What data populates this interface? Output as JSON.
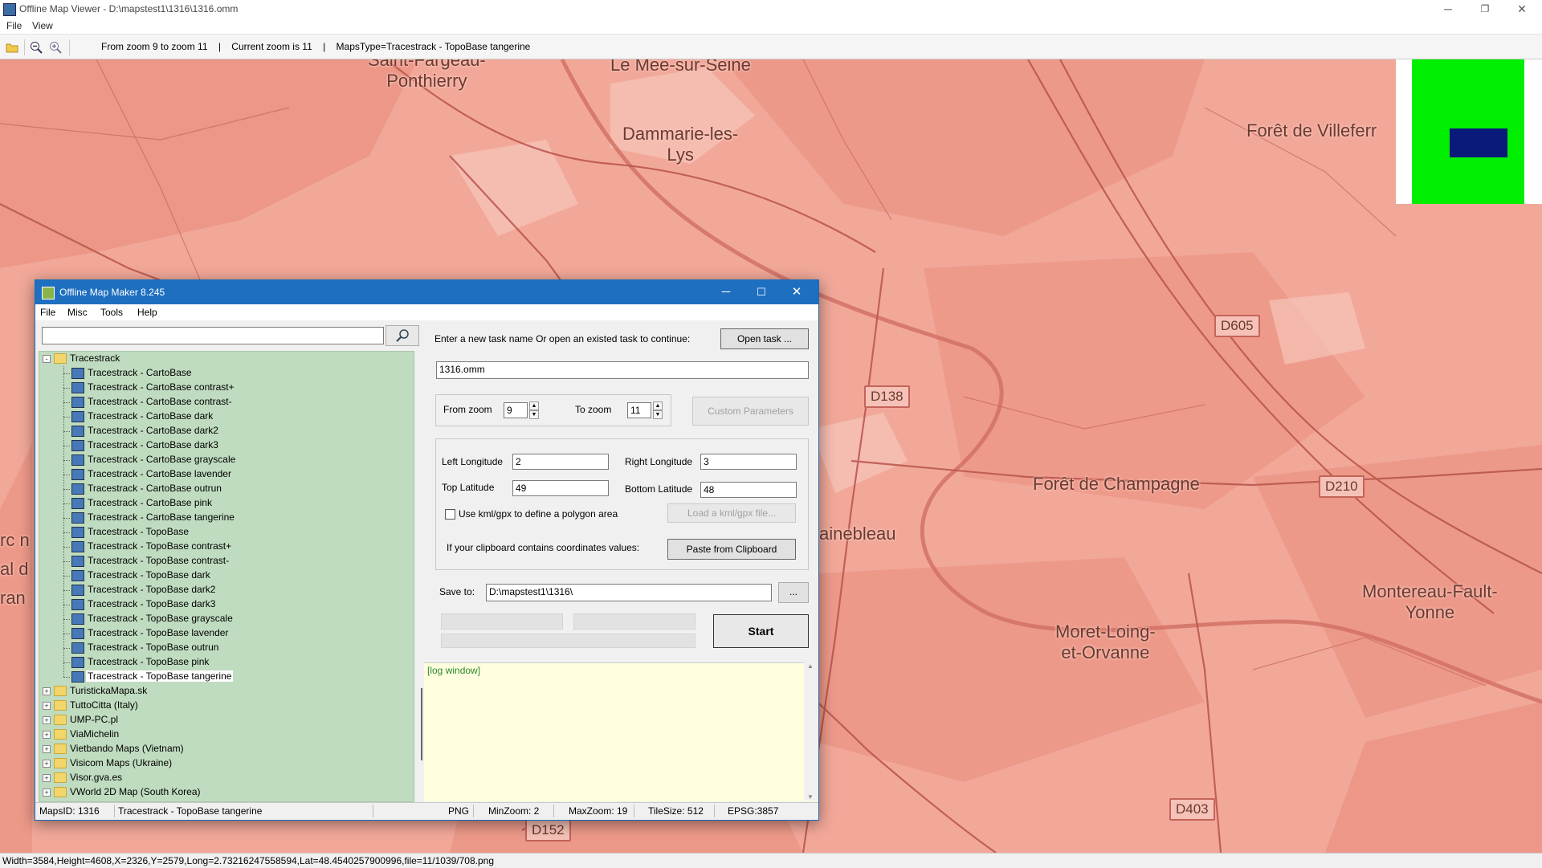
{
  "window": {
    "title": "Offline Map Viewer - D:\\mapstest1\\1316\\1316.omm",
    "menu": [
      "File",
      "View"
    ],
    "controls": {
      "minimize": "─",
      "maximize": "❐",
      "close": "✕"
    }
  },
  "toolbar": {
    "info": "From zoom 9 to zoom 11    |    Current zoom is 11    |    MapsType=Tracestrack - TopoBase tangerine"
  },
  "map": {
    "places": [
      "Saint-Fargeau-\nPonthierry",
      "Le Mee-sur-Seine",
      "Dammarie-les-\nLys",
      "Forêt de Villeferr",
      "Forêt de Champagne",
      "ainebleau",
      "Moret-Loing-\net-Orvanne",
      "Montereau-Fault-\nYonne",
      "rc n",
      "al d",
      "ran"
    ],
    "roads": [
      "D605",
      "D138",
      "D210",
      "D152",
      "D403"
    ]
  },
  "statusbar": {
    "text": "Width=3584,Height=4608,X=2326,Y=2579,Long=2.73216247558594,Lat=48.4540257900996,file=11/1039/708.png"
  },
  "dialog": {
    "title": "Offline Map Maker 8.245",
    "menu": [
      "File",
      "Misc",
      "Tools",
      "Help"
    ],
    "tree": {
      "root": "Tracestrack",
      "children": [
        "Tracestrack - CartoBase",
        "Tracestrack - CartoBase contrast+",
        "Tracestrack - CartoBase contrast-",
        "Tracestrack - CartoBase dark",
        "Tracestrack - CartoBase dark2",
        "Tracestrack - CartoBase dark3",
        "Tracestrack - CartoBase grayscale",
        "Tracestrack - CartoBase lavender",
        "Tracestrack - CartoBase outrun",
        "Tracestrack - CartoBase pink",
        "Tracestrack - CartoBase tangerine",
        "Tracestrack - TopoBase",
        "Tracestrack - TopoBase contrast+",
        "Tracestrack - TopoBase contrast-",
        "Tracestrack - TopoBase dark",
        "Tracestrack - TopoBase dark2",
        "Tracestrack - TopoBase dark3",
        "Tracestrack - TopoBase grayscale",
        "Tracestrack - TopoBase lavender",
        "Tracestrack - TopoBase outrun",
        "Tracestrack - TopoBase pink",
        "Tracestrack - TopoBase tangerine"
      ],
      "selected": "Tracestrack - TopoBase tangerine",
      "other_roots": [
        "TuristickaMapa.sk",
        "TuttoCitta (Italy)",
        "UMP-PC.pl",
        "ViaMichelin",
        "Vietbando Maps (Vietnam)",
        "Visicom Maps (Ukraine)",
        "Visor.gva.es",
        "VWorld 2D Map (South Korea)"
      ]
    },
    "task_prompt": "Enter a new task name Or open an existed task to continue:",
    "open_task_button": "Open task ...",
    "task_name": "1316.omm",
    "from_zoom_label": "From zoom",
    "from_zoom": "9",
    "to_zoom_label": "To zoom",
    "to_zoom": "11",
    "custom_params_button": "Custom Parameters",
    "left_lon_label": "Left Longitude",
    "left_lon": "2",
    "right_lon_label": "Right Longitude",
    "right_lon": "3",
    "top_lat_label": "Top Latitude",
    "top_lat": "49",
    "bottom_lat_label": "Bottom Latitude",
    "bottom_lat": "48",
    "kml_checkbox_label": "Use kml/gpx to define a polygon area",
    "kml_button": "Load a kml/gpx file...",
    "clipboard_label": "If your clipboard contains coordinates values:",
    "clipboard_button": "Paste from Clipboard",
    "save_label": "Save to:",
    "save_path": "D:\\mapstest1\\1316\\",
    "browse_button": "...",
    "start_button": "Start",
    "log_text": "[log window]",
    "status": {
      "maps_id": "MapsID: 1316",
      "map_name": "Tracestrack - TopoBase tangerine",
      "format": "PNG",
      "min_zoom": "MinZoom: 2",
      "max_zoom": "MaxZoom: 19",
      "tile_size": "TileSize: 512",
      "epsg": "EPSG:3857"
    }
  },
  "colors": {
    "map_base": "#f2a899",
    "map_dark": "#e8897a",
    "road_line": "#b8534a",
    "tree_bg": "#c0dcc0",
    "log_bg": "#ffffe0",
    "dialog_title": "#1f6fc0",
    "minimap_green": "#00ee00",
    "minimap_blue": "#0a1a7a"
  }
}
